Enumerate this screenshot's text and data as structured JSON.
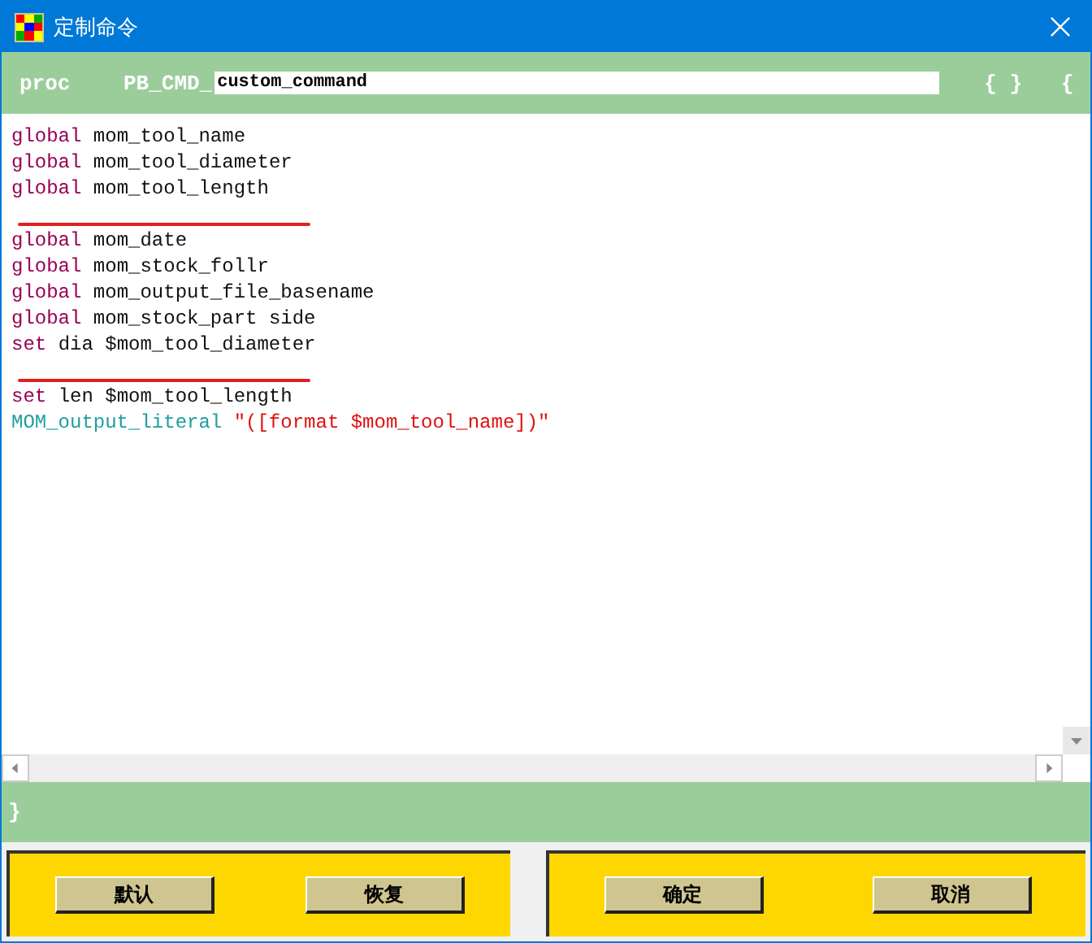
{
  "window": {
    "title": "定制命令"
  },
  "header": {
    "keyword": "proc",
    "prefix": "PB_CMD_",
    "name_field": {
      "value": "custom_command"
    },
    "braces": "{ }",
    "open_brace": "{"
  },
  "code_lines": [
    {
      "kind": "code",
      "tokens": [
        {
          "kind": "keyword",
          "text": "global"
        },
        {
          "kind": "plain",
          "text": "mom_tool_name"
        }
      ]
    },
    {
      "kind": "code",
      "tokens": [
        {
          "kind": "keyword",
          "text": "global"
        },
        {
          "kind": "plain",
          "text": "mom_tool_diameter"
        }
      ]
    },
    {
      "kind": "code",
      "tokens": [
        {
          "kind": "keyword",
          "text": "global"
        },
        {
          "kind": "plain",
          "text": "mom_tool_length"
        }
      ]
    },
    {
      "kind": "mark"
    },
    {
      "kind": "code",
      "tokens": [
        {
          "kind": "keyword",
          "text": "global"
        },
        {
          "kind": "plain",
          "text": "mom_date"
        }
      ]
    },
    {
      "kind": "code",
      "tokens": [
        {
          "kind": "keyword",
          "text": "global"
        },
        {
          "kind": "plain",
          "text": "mom_stock_follr"
        }
      ]
    },
    {
      "kind": "code",
      "tokens": [
        {
          "kind": "keyword",
          "text": "global"
        },
        {
          "kind": "plain",
          "text": "mom_output_file_basename"
        }
      ]
    },
    {
      "kind": "code",
      "tokens": [
        {
          "kind": "keyword",
          "text": "global"
        },
        {
          "kind": "plain",
          "text": "mom_stock_part side"
        }
      ]
    },
    {
      "kind": "code",
      "tokens": [
        {
          "kind": "keyword",
          "text": "set"
        },
        {
          "kind": "plain",
          "text": "dia $mom_tool_diameter"
        }
      ]
    },
    {
      "kind": "mark"
    },
    {
      "kind": "code",
      "tokens": [
        {
          "kind": "keyword",
          "text": "set"
        },
        {
          "kind": "plain",
          "text": "len $mom_tool_length"
        }
      ]
    },
    {
      "kind": "code",
      "tokens": [
        {
          "kind": "command",
          "text": "MOM_output_literal"
        },
        {
          "kind": "string",
          "text": "\"([format $mom_tool_name])\""
        }
      ]
    }
  ],
  "footer": {
    "close_brace": "}"
  },
  "button_groups": [
    [
      "默认",
      "恢复"
    ],
    [
      "确定",
      "取消"
    ]
  ]
}
